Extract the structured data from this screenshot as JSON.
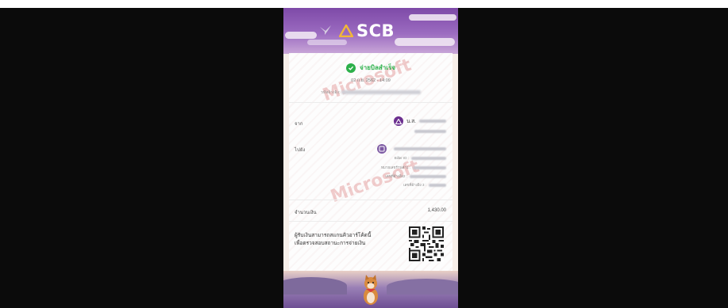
{
  "brand": {
    "name": "SCB"
  },
  "receipt": {
    "status": "จ่ายบิลสำเร็จ",
    "datetime": "02 ก.ย. 2562 - 14:09",
    "ref_label": "รหัสอ้างอิง:",
    "watermark": "Microsoft",
    "from": {
      "label": "จาก",
      "name": "น.ส. ",
      "name_icon": "scb-logo-icon"
    },
    "to": {
      "label": "ไปยัง",
      "biller_label": "Biller ID :",
      "ref1_label": "หมายเลขร้านค้า1 :",
      "ref2_label": "เลขที่อ้างอิง2 :",
      "ref3_label": "เลขที่อ้างอิง 3 :"
    },
    "amount": {
      "label": "จำนวนเงิน",
      "value": "1,430.00"
    },
    "qr_text": "ผู้รับเงินสามารถสแกนคิวอาร์โค้ดนี้เพื่อตรวจสอบสถานะการจ่ายเงิน"
  },
  "colors": {
    "accent": "#2cb04a",
    "brand_purple": "#6b2f8f",
    "background": "#0b0b0b"
  }
}
